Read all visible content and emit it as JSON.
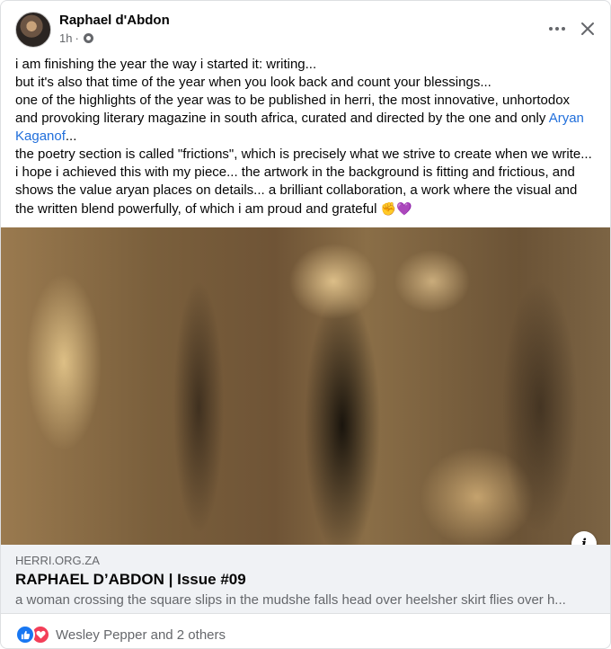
{
  "post": {
    "author": "Raphael d'Abdon",
    "time": "1h",
    "separator": "·",
    "paragraphs": [
      "i am finishing the year the way i started it: writing...",
      "but it's also that time of the year when you look back and count your blessings...",
      "one of the highlights of the year was to be published in herri, the most innovative, unhortodox and provoking literary magazine in south africa, curated and directed by the one and only ",
      "...",
      "the poetry section is called \"frictions\", which is precisely what we strive to create when we write... i hope i achieved this with my piece... the artwork in the background is fitting and frictious, and shows the value aryan places on details... a brilliant collaboration, a work where the visual and the written blend powerfully, of which i am proud and grateful "
    ],
    "mention": "Aryan Kaganof",
    "emojis": "✊💜"
  },
  "link_card": {
    "domain": "HERRI.ORG.ZA",
    "title": "RAPHAEL D’ABDON | Issue #09",
    "description": "a woman crossing the square slips in the mudshe falls head over heelsher skirt flies over h..."
  },
  "reactions": {
    "names": "Wesley Pepper and 2 others",
    "types": [
      "like-icon",
      "love-icon"
    ]
  },
  "icons": {
    "more": "more-options-icon",
    "close": "close-icon",
    "privacy": "globe-icon",
    "info": "info-icon"
  },
  "colors": {
    "link": "#216fdb",
    "like": "#1877f2",
    "love": "#f33e58",
    "secondary_text": "#65676b",
    "card_bg": "#f0f2f5"
  }
}
